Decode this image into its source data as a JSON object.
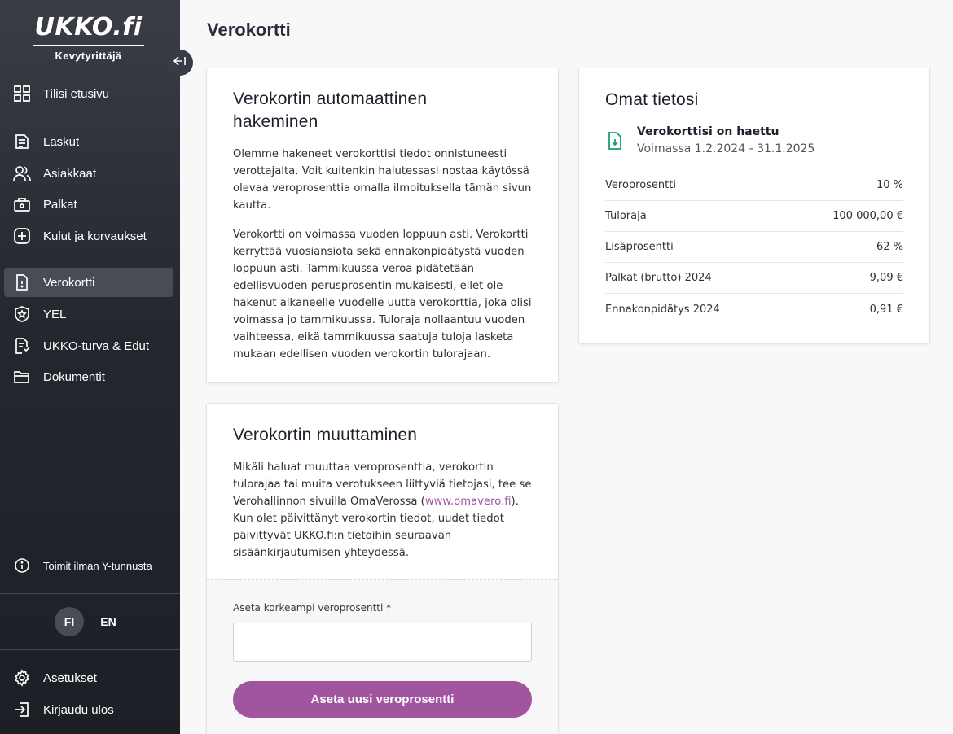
{
  "sidebar": {
    "logo": {
      "main": "UKKO.fi",
      "sub": "Kevytyrittäjä"
    },
    "nav": [
      {
        "label": "Tilisi etusivu",
        "icon": "grid-icon"
      },
      {
        "label": "Laskut",
        "icon": "invoice-icon"
      },
      {
        "label": "Asiakkaat",
        "icon": "users-icon"
      },
      {
        "label": "Palkat",
        "icon": "wallet-icon"
      },
      {
        "label": "Kulut ja korvaukset",
        "icon": "plus-circle-icon"
      },
      {
        "label": "Verokortti",
        "icon": "tax-card-icon",
        "active": true
      },
      {
        "label": "YEL",
        "icon": "shield-icon"
      },
      {
        "label": "UKKO-turva & Edut",
        "icon": "benefits-icon"
      },
      {
        "label": "Dokumentit",
        "icon": "folder-icon"
      }
    ],
    "info_link": "Toimit ilman Y-tunnusta",
    "languages": [
      "FI",
      "EN"
    ],
    "active_language": "FI",
    "settings": "Asetukset",
    "logout": "Kirjaudu ulos"
  },
  "main": {
    "title": "Verokortti",
    "auto_card": {
      "heading": "Verokortin automaattinen hakeminen",
      "p1": "Olemme hakeneet verokorttisi tiedot onnistuneesti verottajalta. Voit kuitenkin halutessasi nostaa käytössä olevaa veroprosenttia omalla ilmoituksella tämän sivun kautta.",
      "p2": "Verokortti on voimassa vuoden loppuun asti. Verokortti kerryttää vuosiansiota sekä ennakonpidätystä vuoden loppuun asti. Tammikuussa veroa pidätetään edellisvuoden perusprosentin mukaisesti, ellet ole hakenut alkaneelle vuodelle uutta verokorttia, joka olisi voimassa jo tammikuussa. Tuloraja nollaantuu vuoden vaihteessa, eikä tammikuussa saatuja tuloja lasketa mukaan edellisen vuoden verokortin tulorajaan."
    },
    "change_card": {
      "heading": "Verokortin muuttaminen",
      "text_before": "Mikäli haluat muuttaa veroprosenttia, verokortin tulorajaa tai muita verotukseen liittyviä tietojasi, tee se Verohallinnon sivuilla OmaVerossa (",
      "link": "www.omavero.fi",
      "text_after": "). Kun olet päivittänyt verokortin tiedot, uudet tiedot päivittyvät UKKO.fi:n tietoihin seuraavan sisäänkirjautumisen yhteydessä.",
      "input_label": "Aseta korkeampi veroprosentti *",
      "input_value": "",
      "button": "Aseta uusi veroprosentti"
    },
    "own_info": {
      "heading": "Omat tietosi",
      "status_title": "Verokorttisi on haettu",
      "status_validity": "Voimassa 1.2.2024 - 31.1.2025",
      "rows": [
        {
          "label": "Veroprosentti",
          "value": "10 %"
        },
        {
          "label": "Tuloraja",
          "value": "100 000,00 €"
        },
        {
          "label": "Lisäprosentti",
          "value": "62 %"
        },
        {
          "label": "Palkat (brutto) 2024",
          "value": "9,09 €"
        },
        {
          "label": "Ennakonpidätys 2024",
          "value": "0,91 €"
        }
      ]
    }
  },
  "colors": {
    "accent": "#a1559f",
    "status_icon": "#1f9a7a",
    "sidebar_bg": "#2a2c34"
  }
}
